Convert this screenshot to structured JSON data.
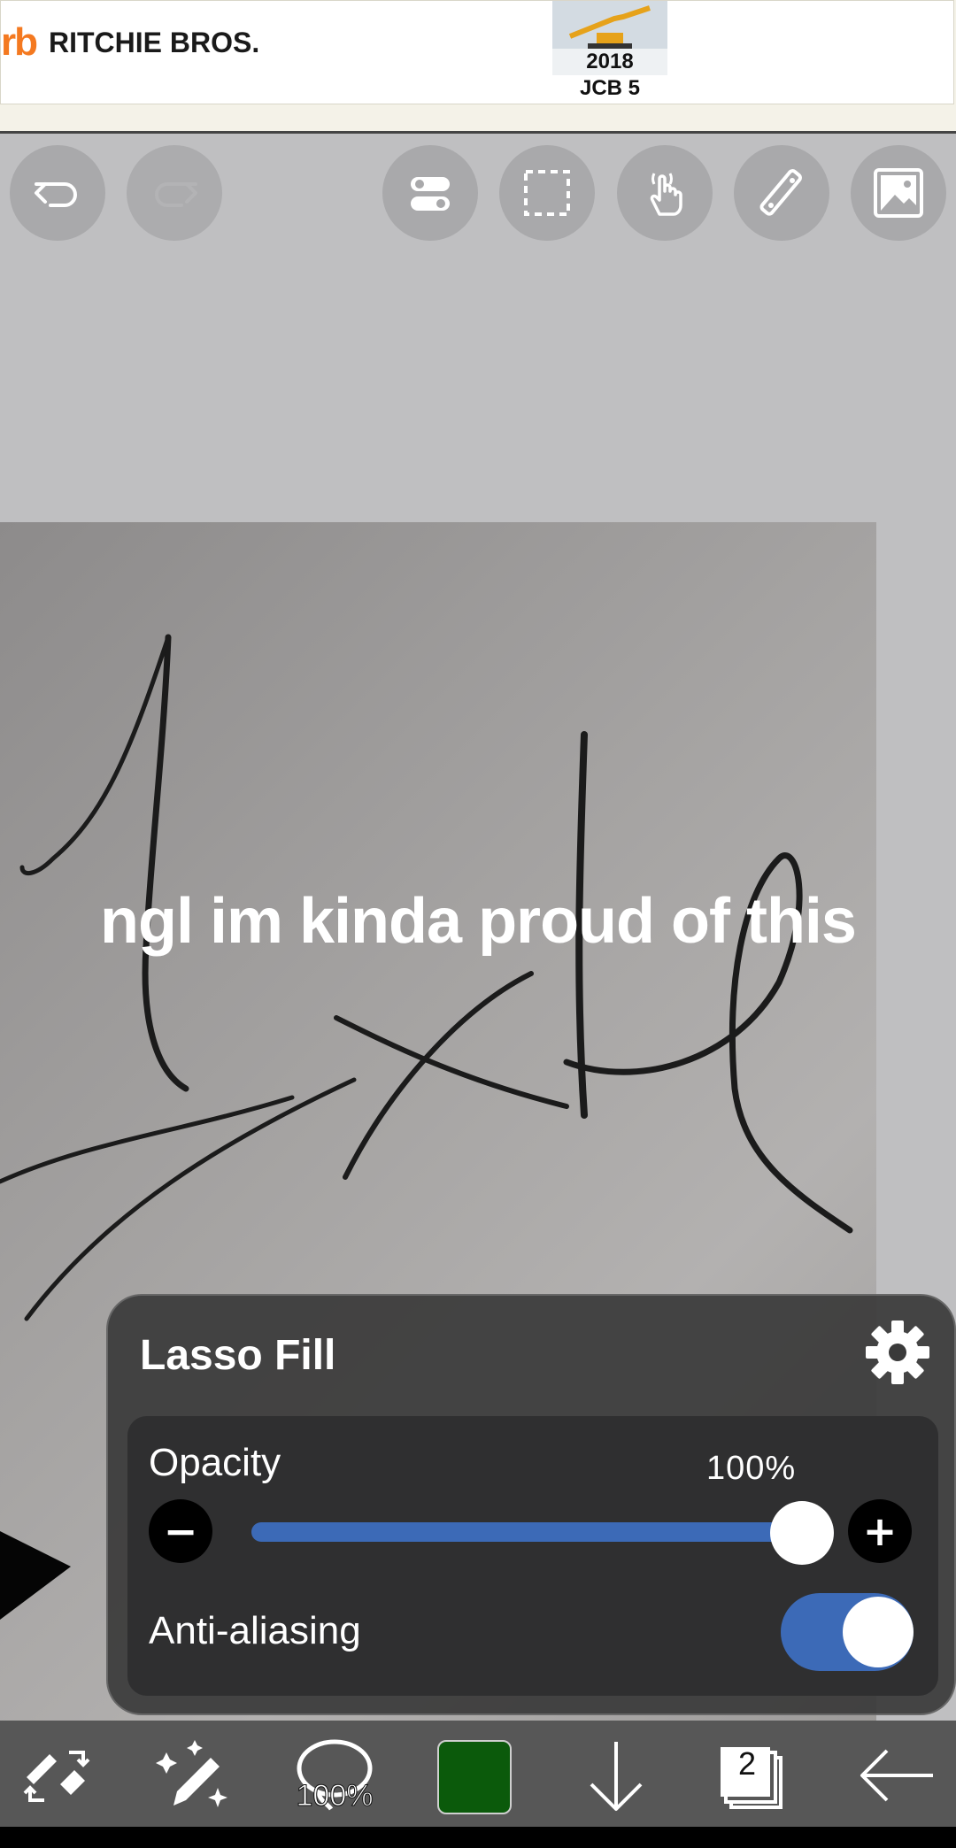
{
  "ad": {
    "brand_mark": "rb",
    "brand_name": "RITCHIE BROS.",
    "item_year": "2018",
    "item_name": "JCB 5"
  },
  "toolbar": {
    "icons": [
      "undo-icon",
      "redo-icon",
      "toggle-settings-icon",
      "selection-icon",
      "hand-touch-icon",
      "ruler-icon",
      "image-icon"
    ]
  },
  "caption": "ngl im kinda proud of this",
  "panel": {
    "title": "Lasso Fill",
    "opacity_label": "Opacity",
    "opacity_value": "100%",
    "opacity_fraction": 1.0,
    "minus_label": "−",
    "plus_label": "+",
    "antialias_label": "Anti-aliasing",
    "antialias_on": true
  },
  "bottom_bar": {
    "brush_size": "100%",
    "color": "#0b5a0b",
    "layer_count": "2"
  },
  "colors": {
    "accent": "#3c6ab7",
    "panel_bg": "#3a3a3a"
  }
}
